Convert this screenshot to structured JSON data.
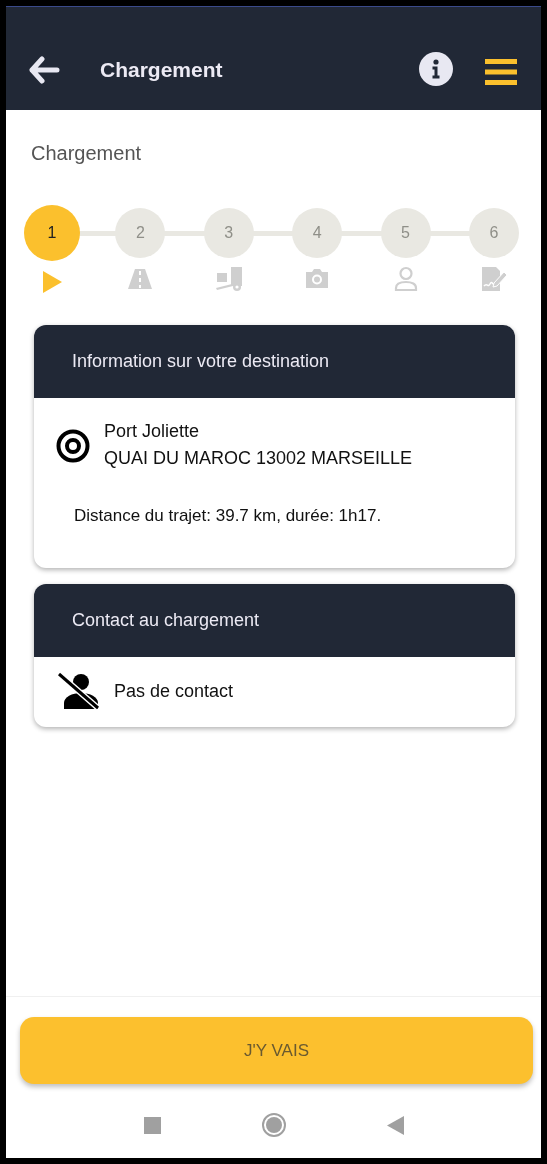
{
  "app_bar": {
    "title": "Chargement"
  },
  "page_title": "Chargement",
  "steps": [
    {
      "number": "1",
      "selected": true
    },
    {
      "number": "2",
      "selected": false
    },
    {
      "number": "3",
      "selected": false
    },
    {
      "number": "4",
      "selected": false
    },
    {
      "number": "5",
      "selected": false
    },
    {
      "number": "6",
      "selected": false
    }
  ],
  "destination_card": {
    "title": "Information sur votre destination",
    "place": "Port Joliette",
    "address": "QUAI DU MAROC 13002 MARSEILLE",
    "trip": "Distance du trajet: 39.7 km, durée: 1h17."
  },
  "contact_card": {
    "title": "Contact au chargement",
    "contact": "Pas de contact"
  },
  "action_button": "J'Y VAIS"
}
